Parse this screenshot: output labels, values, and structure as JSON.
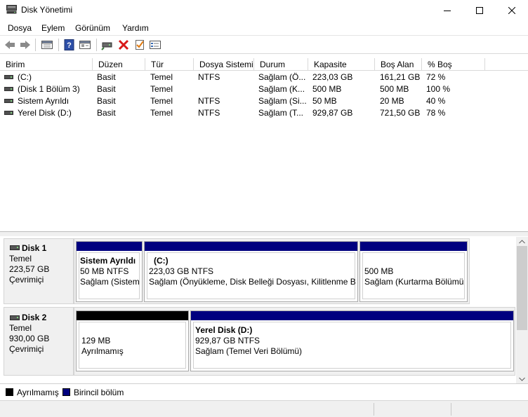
{
  "window": {
    "title": "Disk Yönetimi"
  },
  "menu": [
    "Dosya",
    "Eylem",
    "Görünüm",
    "Yardım"
  ],
  "columns": [
    "Birim",
    "Düzen",
    "Tür",
    "Dosya Sistemi",
    "Durum",
    "Kapasite",
    "Boş Alan",
    "% Boş"
  ],
  "volumes": [
    [
      "(C:)",
      "Basit",
      "Temel",
      "NTFS",
      "Sağlam (Ö...",
      "223,03 GB",
      "161,21 GB",
      "72 %"
    ],
    [
      "(Disk 1 Bölüm 3)",
      "Basit",
      "Temel",
      "",
      "Sağlam (K...",
      "500 MB",
      "500 MB",
      "100 %"
    ],
    [
      "Sistem Ayrıldı",
      "Basit",
      "Temel",
      "NTFS",
      "Sağlam (Si...",
      "50 MB",
      "20 MB",
      "40 %"
    ],
    [
      "Yerel Disk  (D:)",
      "Basit",
      "Temel",
      "NTFS",
      "Sağlam (T...",
      "929,87 GB",
      "721,50 GB",
      "78 %"
    ]
  ],
  "disks": [
    {
      "name": "Disk 1",
      "type": "Temel",
      "size": "223,57 GB",
      "status": "Çevrimiçi",
      "partitions": [
        {
          "title": "Sistem Ayrıldı",
          "size": "50 MB NTFS",
          "status": "Sağlam (Sistem"
        },
        {
          "title": "(C:)",
          "size": "223,03 GB NTFS",
          "status": "Sağlam (Önyükleme, Disk Belleği Dosyası, Kilitlenme Bil"
        },
        {
          "title": "",
          "size": "500 MB",
          "status": "Sağlam (Kurtarma Bölümü"
        }
      ]
    },
    {
      "name": "Disk 2",
      "type": "Temel",
      "size": "930,00 GB",
      "status": "Çevrimiçi",
      "partitions": [
        {
          "title": "",
          "size": "129 MB",
          "status": "Ayrılmamış"
        },
        {
          "title": "Yerel Disk   (D:)",
          "size": "929,87 GB NTFS",
          "status": "Sağlam (Temel Veri Bölümü)"
        }
      ]
    }
  ],
  "legend": {
    "unallocated": "Ayrılmamış",
    "primary": "Birincil bölüm"
  },
  "colors": {
    "primary": "#00007f",
    "unallocated": "#000000"
  },
  "toolbar_icons": [
    "back-icon",
    "forward-icon",
    "disk-list-icon",
    "help-icon",
    "properties-icon",
    "connect-icon",
    "delete-icon",
    "check-icon",
    "settings-icon"
  ]
}
